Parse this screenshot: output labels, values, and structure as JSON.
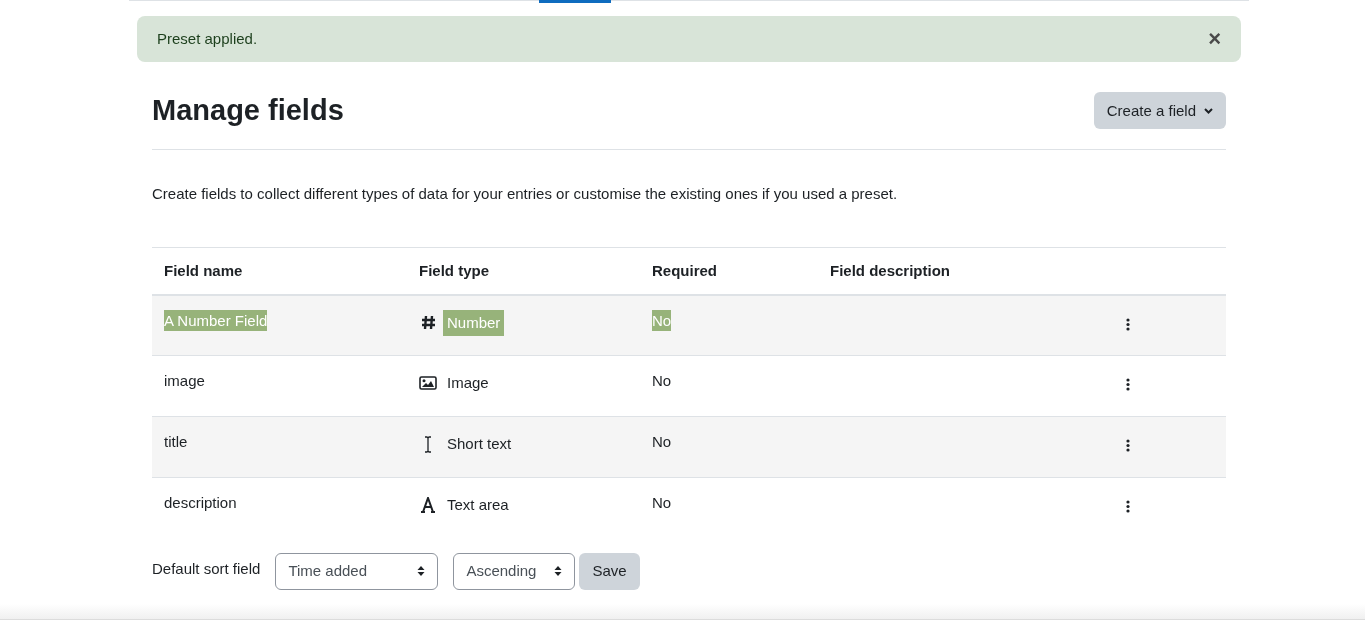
{
  "alert": {
    "message": "Preset applied.",
    "close": "×"
  },
  "heading": "Manage fields",
  "create_button": {
    "label": "Create a field"
  },
  "intro": "Create fields to collect different types of data for your entries or customise the existing ones if you used a preset.",
  "table": {
    "columns": [
      "Field name",
      "Field type",
      "Required",
      "Field description"
    ],
    "rows": [
      {
        "name": "A Number Field",
        "kind": "number",
        "type": "Number",
        "required": "No",
        "highlighted": true
      },
      {
        "name": "image",
        "kind": "image",
        "type": "Image",
        "required": "No",
        "highlighted": false
      },
      {
        "name": "title",
        "kind": "text",
        "type": "Short text",
        "required": "No",
        "highlighted": false
      },
      {
        "name": "description",
        "kind": "textarea",
        "type": "Text area",
        "required": "No",
        "highlighted": false
      }
    ]
  },
  "sort": {
    "label": "Default sort field",
    "field": "Time added",
    "order": "Ascending",
    "save": "Save"
  }
}
